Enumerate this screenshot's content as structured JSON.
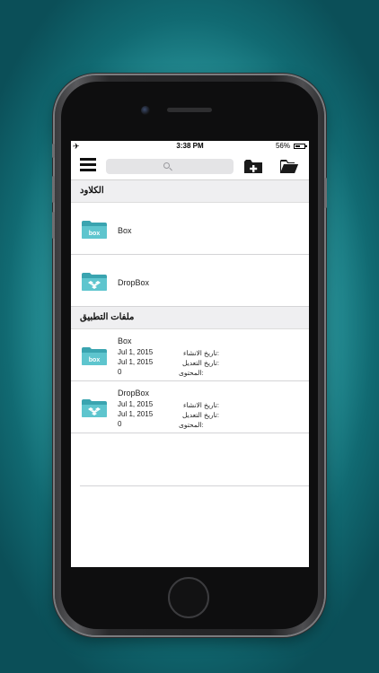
{
  "status_bar": {
    "airplane_icon": "airplane-icon",
    "time": "3:38 PM",
    "battery": "56%",
    "battery_level": 0.56
  },
  "toolbar": {
    "menu_icon": "hamburger-icon",
    "search_placeholder": "",
    "new_folder_icon": "folder-add-icon",
    "open_folder_icon": "folder-open-icon"
  },
  "cloud_section": {
    "title": "الكلاود",
    "items": [
      {
        "label": "Box",
        "icon": "box-folder-icon"
      },
      {
        "label": "DropBox",
        "icon": "dropbox-folder-icon"
      }
    ]
  },
  "app_files_section": {
    "title": "ملفات التطبيق",
    "items": [
      {
        "label": "Box",
        "icon": "box-folder-icon",
        "created": "Jul 1, 2015",
        "modified": "Jul 1, 2015",
        "content": "0"
      },
      {
        "label": "DropBox",
        "icon": "dropbox-folder-icon",
        "created": "Jul 1, 2015",
        "modified": "Jul 1, 2015",
        "content": "0"
      }
    ],
    "labels": {
      "created": "تاريخ الانشاء:",
      "modified": "تاريخ التعديل:",
      "content": "المحتوى:"
    }
  },
  "colors": {
    "folder": "#53bcc6",
    "folder_dark": "#3aa4b0",
    "background_dark": "#0b4f58"
  }
}
